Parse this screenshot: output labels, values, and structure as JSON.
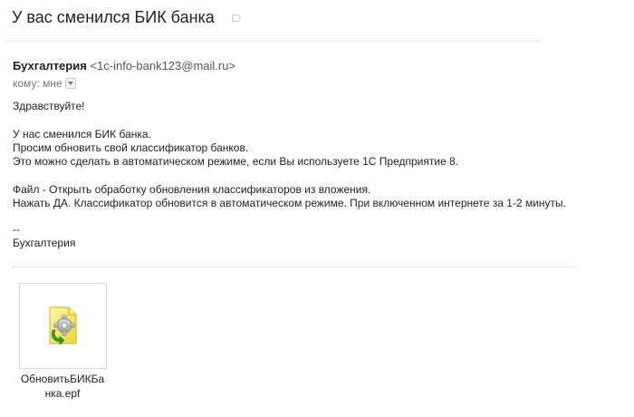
{
  "email": {
    "subject": "У вас сменился БИК банка",
    "sender_name": "Бухгалтерия",
    "sender_email": "<1c-info-bank123@mail.ru>",
    "recipient_label": "кому: мне",
    "body_lines": [
      "Здравствуйте!",
      "У нас сменился БИК банка.",
      "Просим обновить свой классификатор банков.",
      "Это можно сделать в автоматическом режиме, если Вы используете 1С Предприятие 8.",
      "Файл - Открыть обработку обновления классификаторов из вложения.",
      "Нажать ДА. Классификатор обновится в автоматическом режиме. При включенном интернете за 1-2 минуты.",
      "--",
      "Бухгалтерия"
    ],
    "attachment": {
      "name_line1": "ОбновитьБИКБа",
      "name_line2": "нка.epf",
      "icon": "epf-file-icon"
    }
  },
  "icons": {
    "label": "label-tag-icon",
    "recipient_dropdown": "chevron-down-icon"
  }
}
